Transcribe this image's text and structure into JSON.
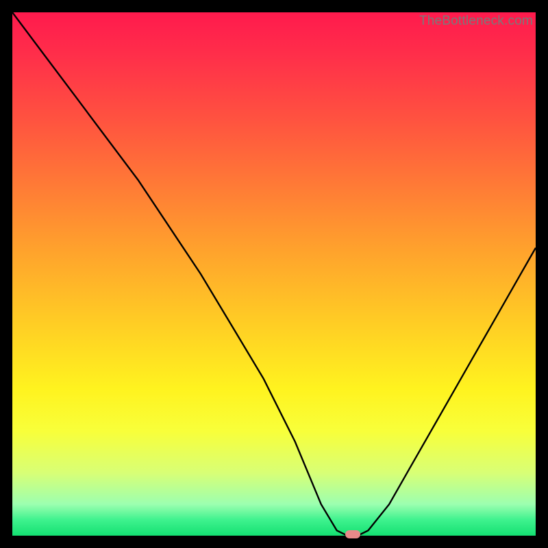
{
  "watermark": "TheBottleneck.com",
  "chart_data": {
    "type": "line",
    "title": "",
    "xlabel": "",
    "ylabel": "",
    "xlim": [
      0,
      100
    ],
    "ylim": [
      0,
      100
    ],
    "x": [
      0,
      6,
      12,
      18,
      24,
      30,
      36,
      42,
      48,
      54,
      59,
      62,
      64,
      66,
      68,
      72,
      76,
      80,
      84,
      88,
      92,
      96,
      100
    ],
    "values": [
      100,
      92,
      84,
      76,
      68,
      59,
      50,
      40,
      30,
      18,
      6,
      1,
      0,
      0,
      1,
      6,
      13,
      20,
      27,
      34,
      41,
      48,
      55
    ],
    "marker": {
      "x": 65,
      "y": 0
    },
    "gradient_stops": [
      {
        "pos": 0,
        "color": "#ff1a4d"
      },
      {
        "pos": 20,
        "color": "#ff5140"
      },
      {
        "pos": 46,
        "color": "#ffa42c"
      },
      {
        "pos": 72,
        "color": "#fff31f"
      },
      {
        "pos": 94,
        "color": "#9cffb0"
      },
      {
        "pos": 100,
        "color": "#14e071"
      }
    ]
  }
}
